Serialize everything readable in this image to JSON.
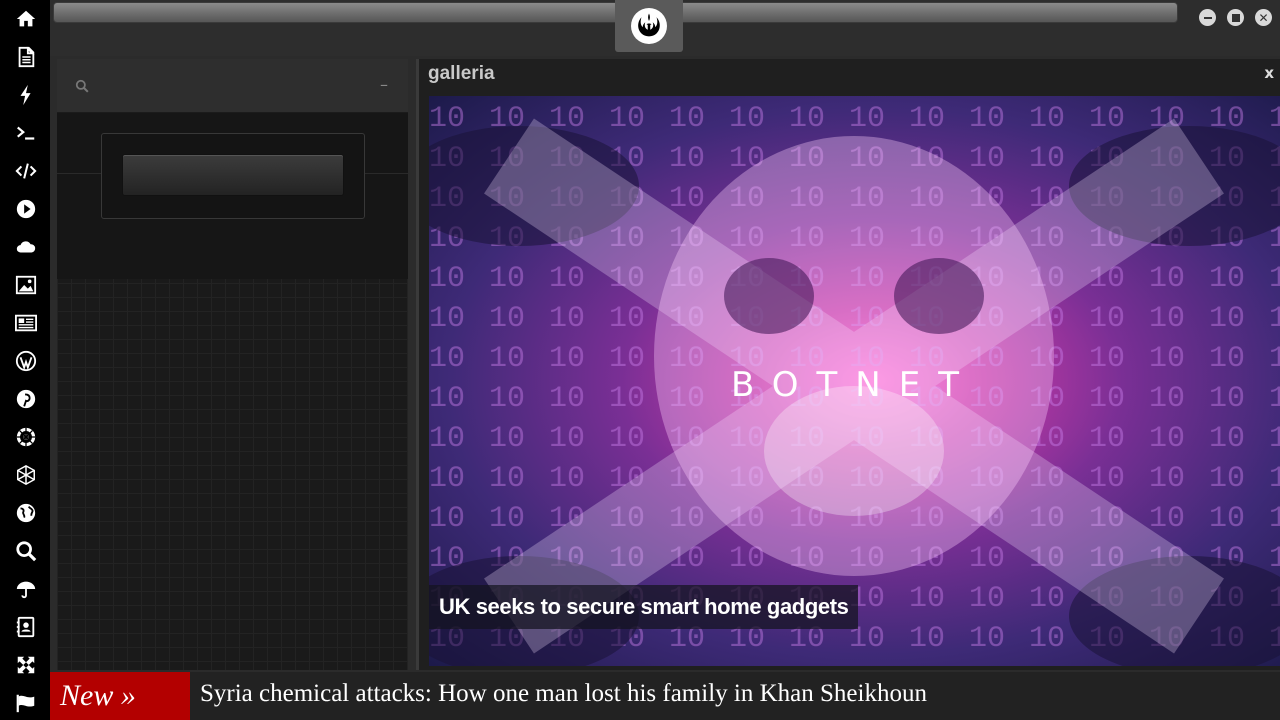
{
  "sidebar": {
    "items": [
      {
        "name": "home",
        "icon": "home-icon"
      },
      {
        "name": "document",
        "icon": "document-icon"
      },
      {
        "name": "flash",
        "icon": "lightning-icon"
      },
      {
        "name": "terminal",
        "icon": "terminal-icon"
      },
      {
        "name": "code",
        "icon": "code-icon"
      },
      {
        "name": "play",
        "icon": "play-icon"
      },
      {
        "name": "cloud",
        "icon": "cloud-icon"
      },
      {
        "name": "image",
        "icon": "image-icon"
      },
      {
        "name": "news",
        "icon": "newspaper-icon"
      },
      {
        "name": "wordpress",
        "icon": "wordpress-icon"
      },
      {
        "name": "pinterest",
        "icon": "pinterest-icon"
      },
      {
        "name": "empire",
        "icon": "empire-icon"
      },
      {
        "name": "network",
        "icon": "network-icon"
      },
      {
        "name": "globe",
        "icon": "globe-icon"
      },
      {
        "name": "search",
        "icon": "search-icon"
      },
      {
        "name": "umbrella",
        "icon": "umbrella-icon"
      },
      {
        "name": "contacts",
        "icon": "contact-book-icon"
      },
      {
        "name": "expand",
        "icon": "expand-icon"
      },
      {
        "name": "flag",
        "icon": "flag-icon"
      }
    ]
  },
  "header": {
    "logo_icon": "rebel-alliance-icon"
  },
  "window_controls": {
    "minimize_icon": "minimize-icon",
    "maximize_icon": "maximize-icon",
    "close_icon": "close-icon"
  },
  "left_panel": {
    "search_icon": "search-icon",
    "collapse_label": "–"
  },
  "gallery": {
    "title": "galleria",
    "close_label": "x",
    "image_text": "BOTNET",
    "caption": "UK seeks to secure smart home gadgets"
  },
  "ticker": {
    "badge": "New »",
    "headline": "Syria chemical attacks: How one man lost his family in Khan Sheikhoun"
  },
  "colors": {
    "sidebar_bg": "#000000",
    "badge_red": "#b30000",
    "panel_bg": "#1a1a1a"
  }
}
